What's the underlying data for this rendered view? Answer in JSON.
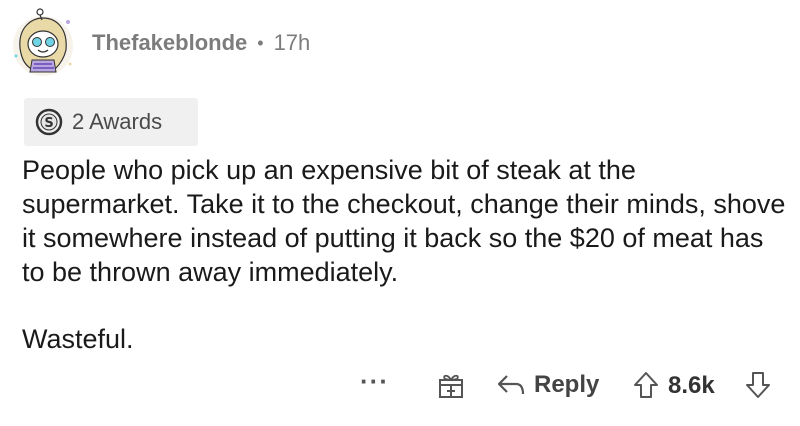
{
  "comment": {
    "username": "Thefakeblonde",
    "separator": "•",
    "time": "17h",
    "awards_label": "2 Awards",
    "body_paragraphs": [
      "People who pick up an expensive bit of steak at the supermarket. Take it to the checkout, change their minds, shove it somewhere instead of putting it back so the $20 of meat has to be thrown away immediately.",
      "Wasteful."
    ]
  },
  "actions": {
    "more_label": "···",
    "reply_label": "Reply",
    "score": "8.6k"
  },
  "icons": {
    "avatar": "avatar-icon",
    "coin": "coin-award-icon",
    "gift": "gift-icon",
    "reply": "reply-arrow-icon",
    "upvote": "upvote-arrow-icon",
    "downvote": "downvote-arrow-icon"
  },
  "colors": {
    "meta_text": "#7c7c7c",
    "body_text": "#1a1a1b",
    "awards_bg": "#f0f0f0"
  }
}
